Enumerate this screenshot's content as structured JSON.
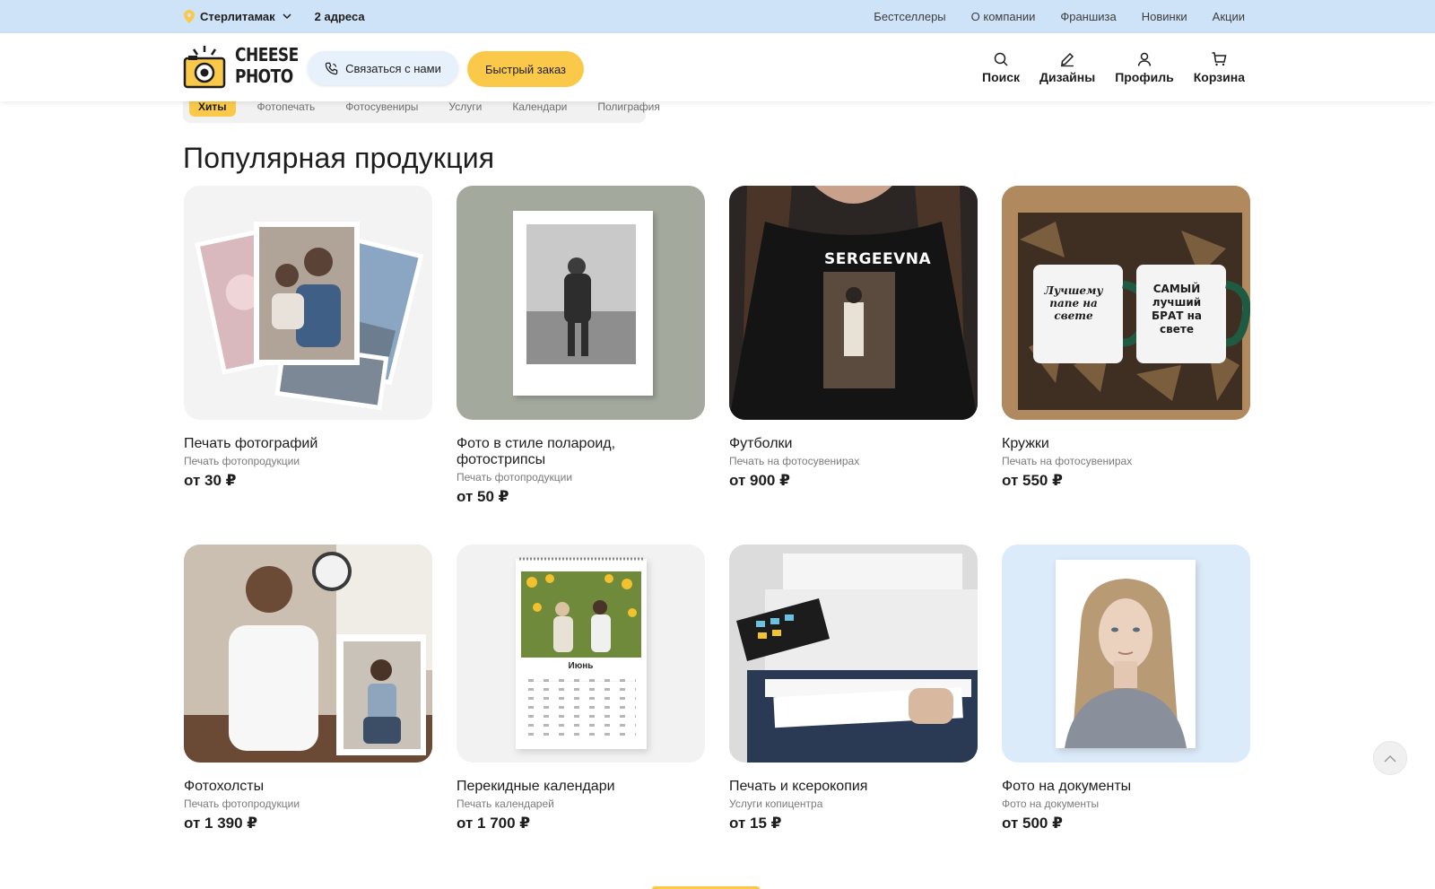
{
  "topbar": {
    "city": "Стерлитамак",
    "addresses": "2 адреса",
    "nav": [
      "Бестселлеры",
      "О компании",
      "Франшиза",
      "Новинки",
      "Акции"
    ]
  },
  "header": {
    "logo_line1": "CHEESE",
    "logo_line2": "PHOTO",
    "contact_button": "Связаться с нами",
    "quick_order_button": "Быстрый заказ",
    "actions": {
      "search": "Поиск",
      "designs": "Дизайны",
      "profile": "Профиль",
      "cart": "Корзина"
    }
  },
  "categories": [
    "Хиты",
    "Фотопечать",
    "Фотосувениры",
    "Услуги",
    "Календари",
    "Полиграфия"
  ],
  "section_title": "Популярная продукция",
  "products": [
    {
      "name": "Печать фотографий",
      "subtitle": "Печать фотопродукции",
      "price": "от 30 ₽"
    },
    {
      "name": "Фото в стиле полароид, фотострипсы",
      "subtitle": "Печать фотопродукции",
      "price": "от 50 ₽"
    },
    {
      "name": "Футболки",
      "subtitle": "Печать на фотосувенирах",
      "price": "от 900 ₽",
      "print_text": "SERGEEVNA"
    },
    {
      "name": "Кружки",
      "subtitle": "Печать на фотосувенирах",
      "price": "от 550 ₽",
      "mug1_text": "Лучшему папе на свете",
      "mug2_text": "САМЫЙ лучший БРАТ на свете"
    },
    {
      "name": "Фотохолсты",
      "subtitle": "Печать фотопродукции",
      "price": "от 1 390 ₽"
    },
    {
      "name": "Перекидные календари",
      "subtitle": "Печать календарей",
      "price": "от 1 700 ₽",
      "month": "Июнь"
    },
    {
      "name": "Печать и ксерокопия",
      "subtitle": "Услуги копицентра",
      "price": "от 15 ₽"
    },
    {
      "name": "Фото на документы",
      "subtitle": "Фото на документы",
      "price": "от 500 ₽"
    }
  ],
  "colors": {
    "accent_yellow": "#fbc94a",
    "topbar_blue": "#cfe3f8",
    "contact_button_bg": "#e7f1fb"
  }
}
